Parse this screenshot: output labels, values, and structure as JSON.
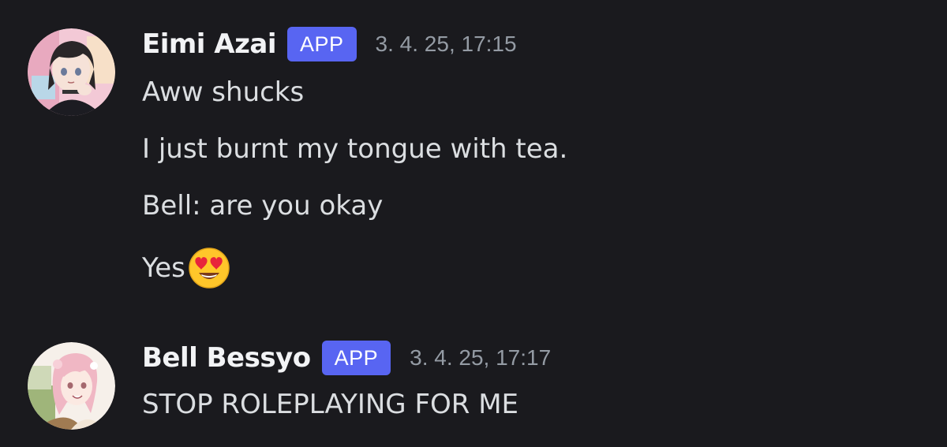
{
  "messages": [
    {
      "username": "Eimi Azai",
      "badge": "APP",
      "timestamp": "3. 4. 25, 17:15",
      "avatar_icon": "avatar-eimi-icon",
      "lines": [
        "Aww shucks",
        "I just burnt my tongue with tea.",
        "Bell: are you okay",
        "Yes"
      ],
      "emoji": "heart-eyes-emoji"
    },
    {
      "username": "Bell Bessyo",
      "badge": "APP",
      "timestamp": "3. 4. 25, 17:17",
      "avatar_icon": "avatar-bell-icon",
      "lines": [
        "STOP ROLEPLAYING FOR ME"
      ]
    }
  ],
  "colors": {
    "background": "#1a1a1e",
    "badge": "#5865f2",
    "username": "#f2f3f5",
    "text": "#dbdee1",
    "timestamp": "#949ba4"
  }
}
